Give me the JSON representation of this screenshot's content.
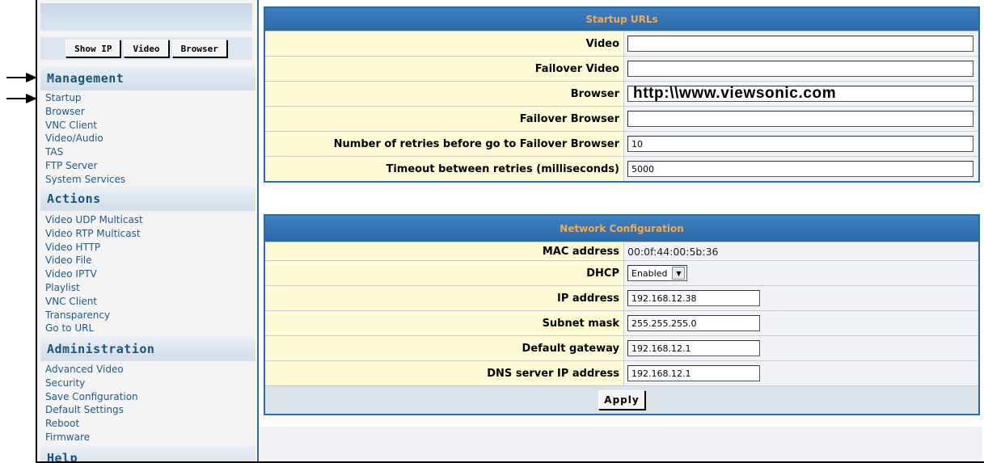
{
  "toolbar": {
    "show_ip": "Show IP",
    "video": "Video",
    "browser": "Browser"
  },
  "sidebar": {
    "management": {
      "title": "Management",
      "items": [
        "Startup",
        "Browser",
        "VNC Client",
        "Video/Audio",
        "TAS",
        "FTP Server",
        "System Services"
      ]
    },
    "actions": {
      "title": "Actions",
      "items": [
        "Video UDP Multicast",
        "Video RTP Multicast",
        "Video HTTP",
        "Video File",
        "Video IPTV",
        "Playlist",
        "VNC Client",
        "Transparency",
        "Go to URL"
      ]
    },
    "administration": {
      "title": "Administration",
      "items": [
        "Advanced Video",
        "Security",
        "Save Configuration",
        "Default Settings",
        "Reboot",
        "Firmware"
      ]
    },
    "help": {
      "title": "Help"
    }
  },
  "startup": {
    "title": "Startup URLs",
    "rows": [
      {
        "label": "Video",
        "value": ""
      },
      {
        "label": "Failover Video",
        "value": ""
      },
      {
        "label": "Browser",
        "value": "http:\\\\www.viewsonic.com"
      },
      {
        "label": "Failover Browser",
        "value": ""
      },
      {
        "label": "Number of retries before go to Failover Browser",
        "value": "10"
      },
      {
        "label": "Timeout between retries (milliseconds)",
        "value": "5000"
      }
    ]
  },
  "network": {
    "title": "Network Configuration",
    "mac_label": "MAC address",
    "mac_value": "00:0f:44:00:5b:36",
    "dhcp_label": "DHCP",
    "dhcp_value": "Enabled",
    "ip_label": "IP address",
    "ip_value": "192.168.12.38",
    "subnet_label": "Subnet mask",
    "subnet_value": "255.255.255.0",
    "gateway_label": "Default gateway",
    "gateway_value": "192.168.12.1",
    "dns_label": "DNS server IP address",
    "dns_value": "192.168.12.1",
    "apply_label": "Apply"
  }
}
